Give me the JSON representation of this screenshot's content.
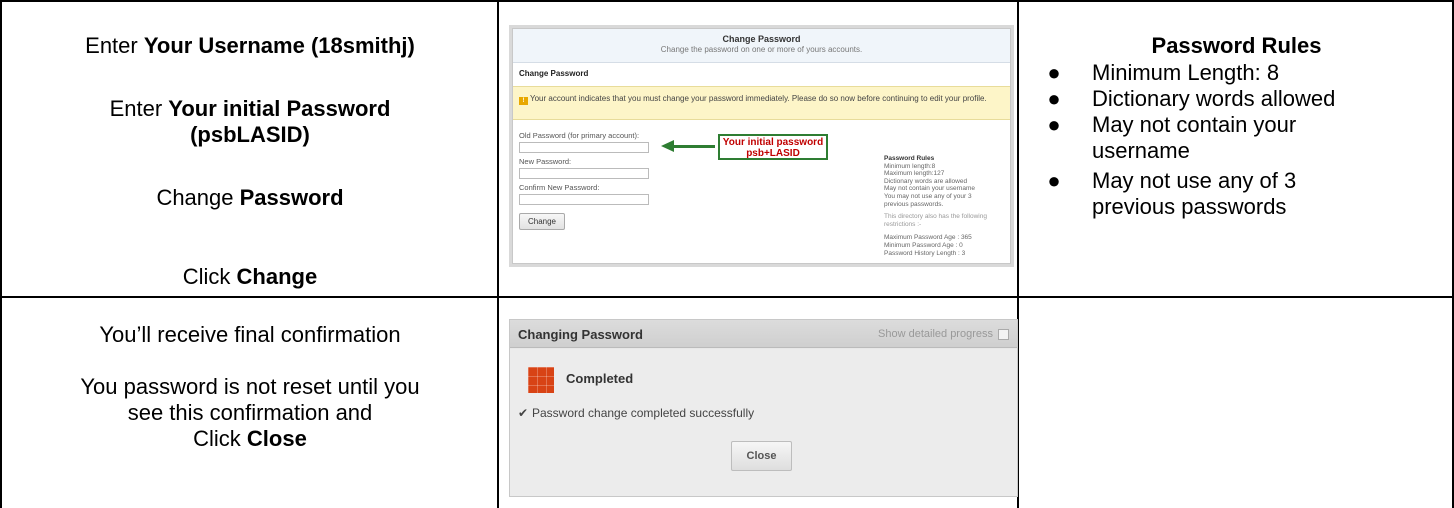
{
  "row1": {
    "instructions": [
      {
        "pre": "Enter ",
        "bold": "Your Username (18smithj)"
      },
      {
        "pre": "Enter ",
        "bold": "Your initial Password (psbLASID)"
      },
      {
        "pre": "Change ",
        "bold": "Password"
      },
      {
        "pre": "Click ",
        "bold": "Change"
      }
    ],
    "screenshot": {
      "header_title": "Change Password",
      "header_subtitle": "Change the password on one or more of yours accounts.",
      "section_title": "Change Password",
      "warning_text": "Your account indicates that you must change your password immediately. Please do so now before continuing to edit your profile.",
      "old_password_label": "Old Password (for primary account):",
      "new_password_label": "New Password:",
      "confirm_password_label": "Confirm New Password:",
      "change_button": "Change",
      "annotation_line1": "Your initial password",
      "annotation_line2": "psb+LASID",
      "side_rules": {
        "title": "Password Rules",
        "lines": [
          "Minimum length:8",
          "Maximum length:127",
          "Dictionary words are allowed",
          "May not contain your username",
          "You may not use any of your 3",
          "previous passwords."
        ],
        "directory_note_1": "This directory also has the following",
        "directory_note_2": "restrictions :-",
        "restrictions": [
          "Maximum Password Age : 365",
          "Minimum Password Age : 0",
          "Password History Length : 3"
        ]
      }
    },
    "rules": {
      "title": "Password Rules",
      "items": [
        "Minimum Length: 8",
        "Dictionary words allowed",
        "May not contain your username",
        "May not use any of 3 previous passwords"
      ]
    }
  },
  "row2": {
    "instructions": {
      "line1": "You’ll receive final confirmation",
      "line2": "You password is not reset until you",
      "line3": "see this confirmation and",
      "line4_pre": "Click ",
      "line4_bold": "Close"
    },
    "dialog": {
      "title": "Changing Password",
      "show_progress": "Show detailed progress",
      "status": "Completed",
      "check_glyph": "✔",
      "message": "Password change completed successfully",
      "close_button": "Close"
    }
  }
}
